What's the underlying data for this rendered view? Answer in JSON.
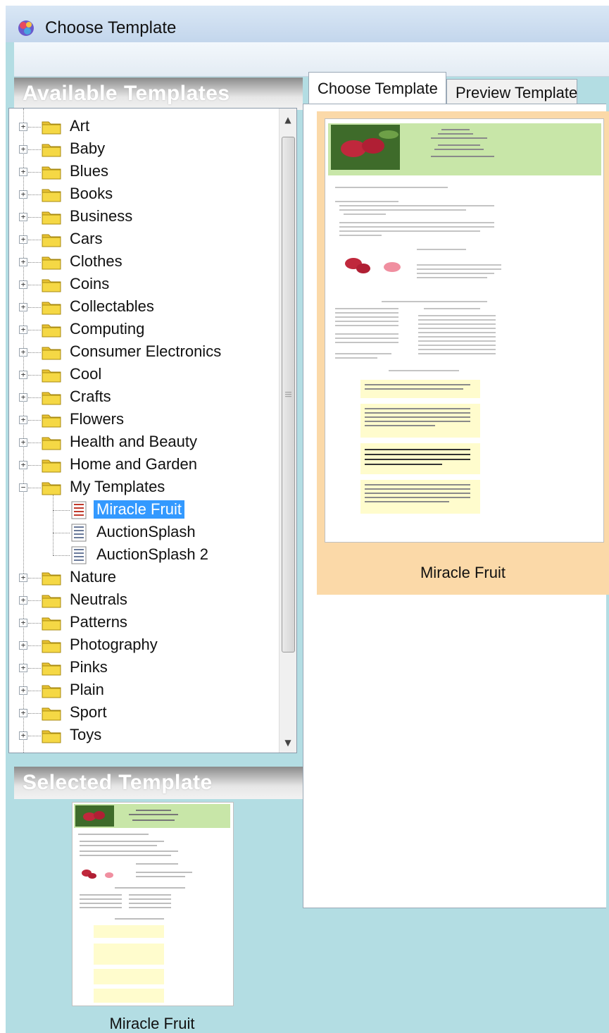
{
  "window": {
    "title": "Choose Template"
  },
  "left": {
    "available_header": "Available Templates",
    "selected_header": "Selected Template",
    "tree": {
      "folders_before": [
        "Art",
        "Baby",
        "Blues",
        "Books",
        "Business",
        "Cars",
        "Clothes",
        "Coins",
        "Collectables",
        "Computing",
        "Consumer Electronics",
        "Cool",
        "Crafts",
        "Flowers",
        "Health and Beauty",
        "Home and Garden"
      ],
      "expanded_folder": "My Templates",
      "templates": [
        "Miracle Fruit",
        "AuctionSplash",
        "AuctionSplash 2"
      ],
      "selected_template": "Miracle Fruit",
      "folders_after": [
        "Nature",
        "Neutrals",
        "Patterns",
        "Photography",
        "Pinks",
        "Plain",
        "Sport",
        "Toys"
      ]
    },
    "selected_caption": "Miracle Fruit"
  },
  "tabs": [
    {
      "label": "Choose Template",
      "active": true
    },
    {
      "label": "Preview Template",
      "active": false
    }
  ],
  "preview": {
    "caption": "Miracle Fruit"
  },
  "colors": {
    "background": "#b3dde3",
    "card": "#fbd9a8",
    "selection": "#3399ff",
    "template_header": "#c8e6a8"
  }
}
